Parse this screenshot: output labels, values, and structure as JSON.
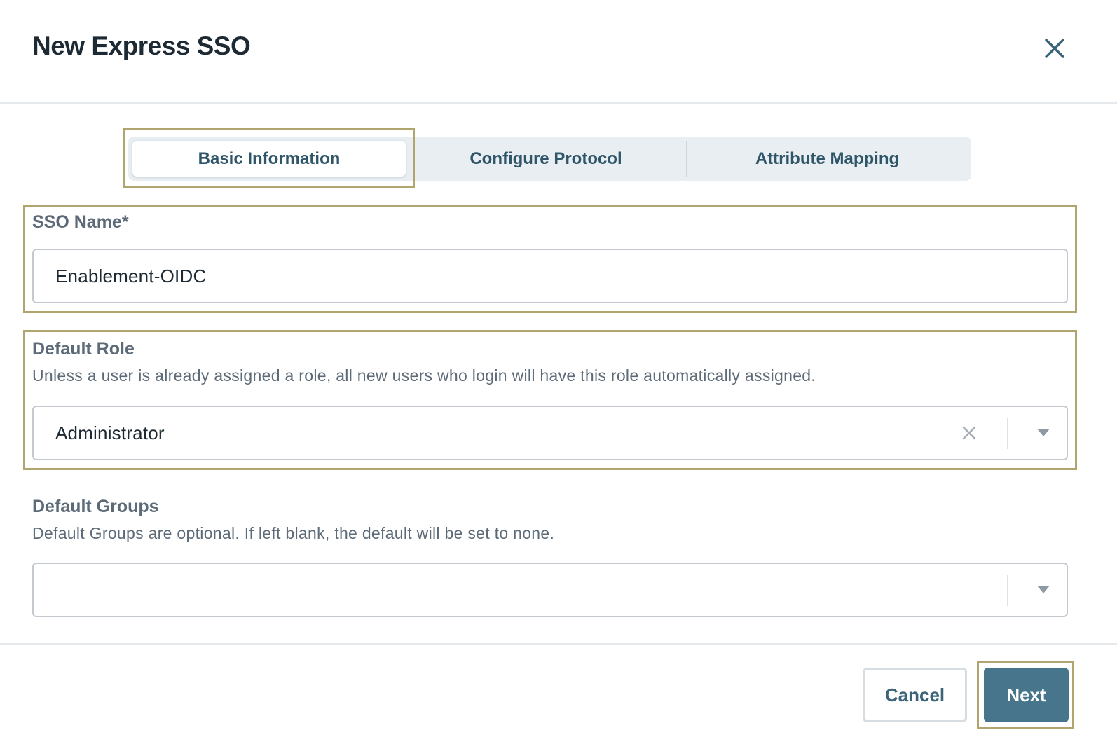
{
  "dialog": {
    "title": "New Express SSO"
  },
  "tabs": [
    {
      "label": "Basic Information",
      "active": true
    },
    {
      "label": "Configure Protocol",
      "active": false
    },
    {
      "label": "Attribute Mapping",
      "active": false
    }
  ],
  "sso_name": {
    "label": "SSO Name*",
    "value": "Enablement-OIDC"
  },
  "default_role": {
    "label": "Default Role",
    "help": "Unless a user is already assigned a role, all new users who login will have this role automatically assigned.",
    "value": "Administrator"
  },
  "default_groups": {
    "label": "Default Groups",
    "help": "Default Groups are optional. If left blank, the default will be set to none.",
    "value": ""
  },
  "footer": {
    "cancel_label": "Cancel",
    "next_label": "Next"
  },
  "icons": {
    "close": "close-icon",
    "clear": "clear-icon",
    "dropdown": "chevron-down-icon"
  },
  "colors": {
    "primary": "#46758c",
    "highlight": "#b1a56f",
    "tab_bg": "#e8eef2"
  }
}
